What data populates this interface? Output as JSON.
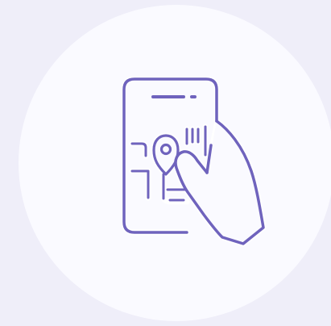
{
  "illustration": {
    "subject": "hand-holding-phone-with-map-icon",
    "colors": {
      "page_background": "#efeef9",
      "circle_background": "#fafaff",
      "icon_stroke": "#6f63bd",
      "icon_outline": "#ffffff"
    }
  }
}
